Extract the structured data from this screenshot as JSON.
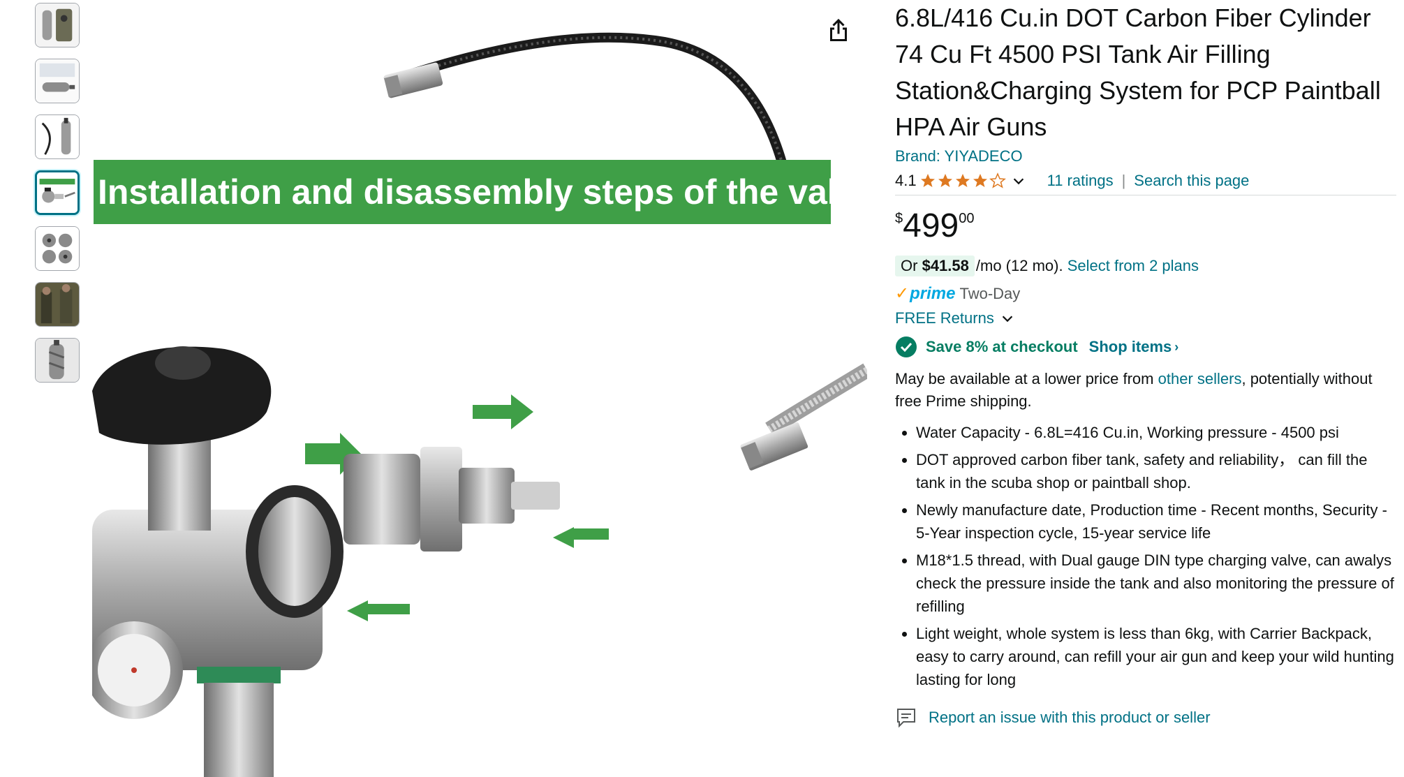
{
  "thumbnails": [
    {
      "name": "thumb-tank-kit"
    },
    {
      "name": "thumb-tank-label"
    },
    {
      "name": "thumb-hose-tank"
    },
    {
      "name": "thumb-valve-steps",
      "selected": true
    },
    {
      "name": "thumb-parts-grid"
    },
    {
      "name": "thumb-hunters"
    },
    {
      "name": "thumb-camo-tank"
    }
  ],
  "main_image": {
    "banner": "Installation and disassembly steps of the valve",
    "accent_color": "#3f9f47"
  },
  "product": {
    "title": "6.8L/416 Cu.in DOT Carbon Fiber Cylinder 74 Cu Ft 4500 PSI Tank Air Filling Station&Charging System for PCP Paintball HPA Air Guns",
    "brand": "Brand: YIYADECO",
    "rating_value": "4.1",
    "rating_stars": 4.1,
    "ratings_count": "11 ratings",
    "search_page": "Search this page",
    "separator": "|",
    "price_symbol": "$",
    "price_whole": "499",
    "price_fraction": "00",
    "monthly_prefix": "Or",
    "monthly_amount": "$41.58",
    "monthly_suffix": "/mo (12 mo).",
    "monthly_link": "Select from 2 plans",
    "prime_label": "prime",
    "prime_delivery": "Two-Day",
    "returns": "FREE Returns",
    "save_text": "Save 8% at checkout",
    "shop_items": "Shop items",
    "lower_price_prefix": "May be available at a lower price from",
    "lower_price_link": "other sellers",
    "lower_price_suffix": ", potentially without free Prime shipping.",
    "bullets": [
      "Water Capacity - 6.8L=416 Cu.in, Working pressure - 4500 psi",
      "DOT approved carbon fiber tank, safety and reliability， can fill the tank in the scuba shop or paintball shop.",
      "Newly manufacture date, Production time - Recent months, Security - 5-Year inspection cycle, 15-year service life",
      "M18*1.5 thread, with Dual gauge DIN type charging valve, can awalys check the pressure inside the tank and also monitoring the pressure of refilling",
      "Light weight, whole system is less than 6kg, with Carrier Backpack, easy to carry around, can refill your air gun and keep your wild hunting lasting for long"
    ],
    "report_link": "Report an issue with this product or seller"
  },
  "colors": {
    "link": "#007185",
    "star": "#de7921",
    "save_green": "#067d62",
    "prime_blue": "#00a8e1"
  },
  "icons": [
    "share-icon",
    "star-icon",
    "chevron-down-icon",
    "check-circle-icon",
    "report-icon"
  ]
}
